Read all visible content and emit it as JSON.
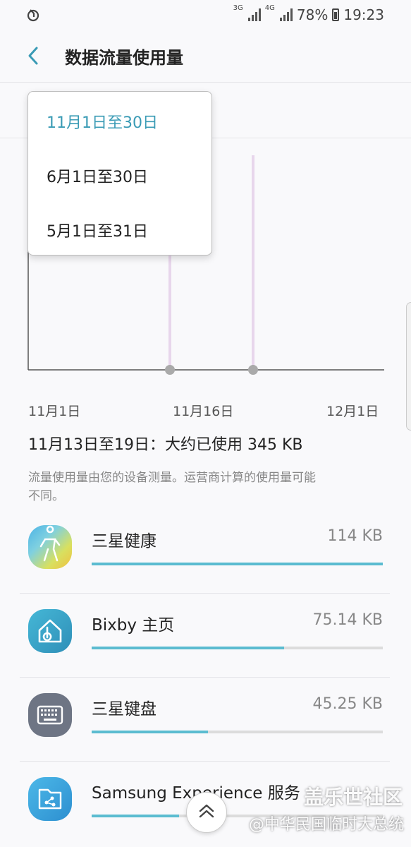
{
  "status_bar": {
    "network1": "3G",
    "network2": "4G",
    "battery": "78%",
    "time": "19:23"
  },
  "header": {
    "title": "数据流量使用量"
  },
  "dropdown": {
    "items": [
      {
        "label": "11月1日至30日",
        "selected": true
      },
      {
        "label": "6月1日至30日",
        "selected": false
      },
      {
        "label": "5月1日至31日",
        "selected": false
      }
    ]
  },
  "chart": {
    "x_labels": [
      "11月1日",
      "11月16日",
      "12月1日"
    ]
  },
  "summary": "11月13日至19日：大约已使用 345 KB",
  "note": "流量使用量由您的设备测量。运营商计算的使用量可能不同。",
  "apps": [
    {
      "name": "三星健康",
      "size": "114 KB",
      "fraction": 1.0,
      "icon": "samsung-health-icon"
    },
    {
      "name": "Bixby 主页",
      "size": "75.14 KB",
      "fraction": 0.66,
      "icon": "bixby-home-icon"
    },
    {
      "name": "三星键盘",
      "size": "45.25 KB",
      "fraction": 0.4,
      "icon": "samsung-keyboard-icon"
    },
    {
      "name": "Samsung Experience 服务",
      "size": "",
      "fraction": 0.3,
      "icon": "samsung-experience-icon"
    }
  ],
  "watermark": {
    "line1": "盖乐世社区",
    "line2": "@中华民国临时大总统"
  },
  "colors": {
    "accent": "#3a9bb5",
    "bar_fill": "#5bbcd0"
  }
}
